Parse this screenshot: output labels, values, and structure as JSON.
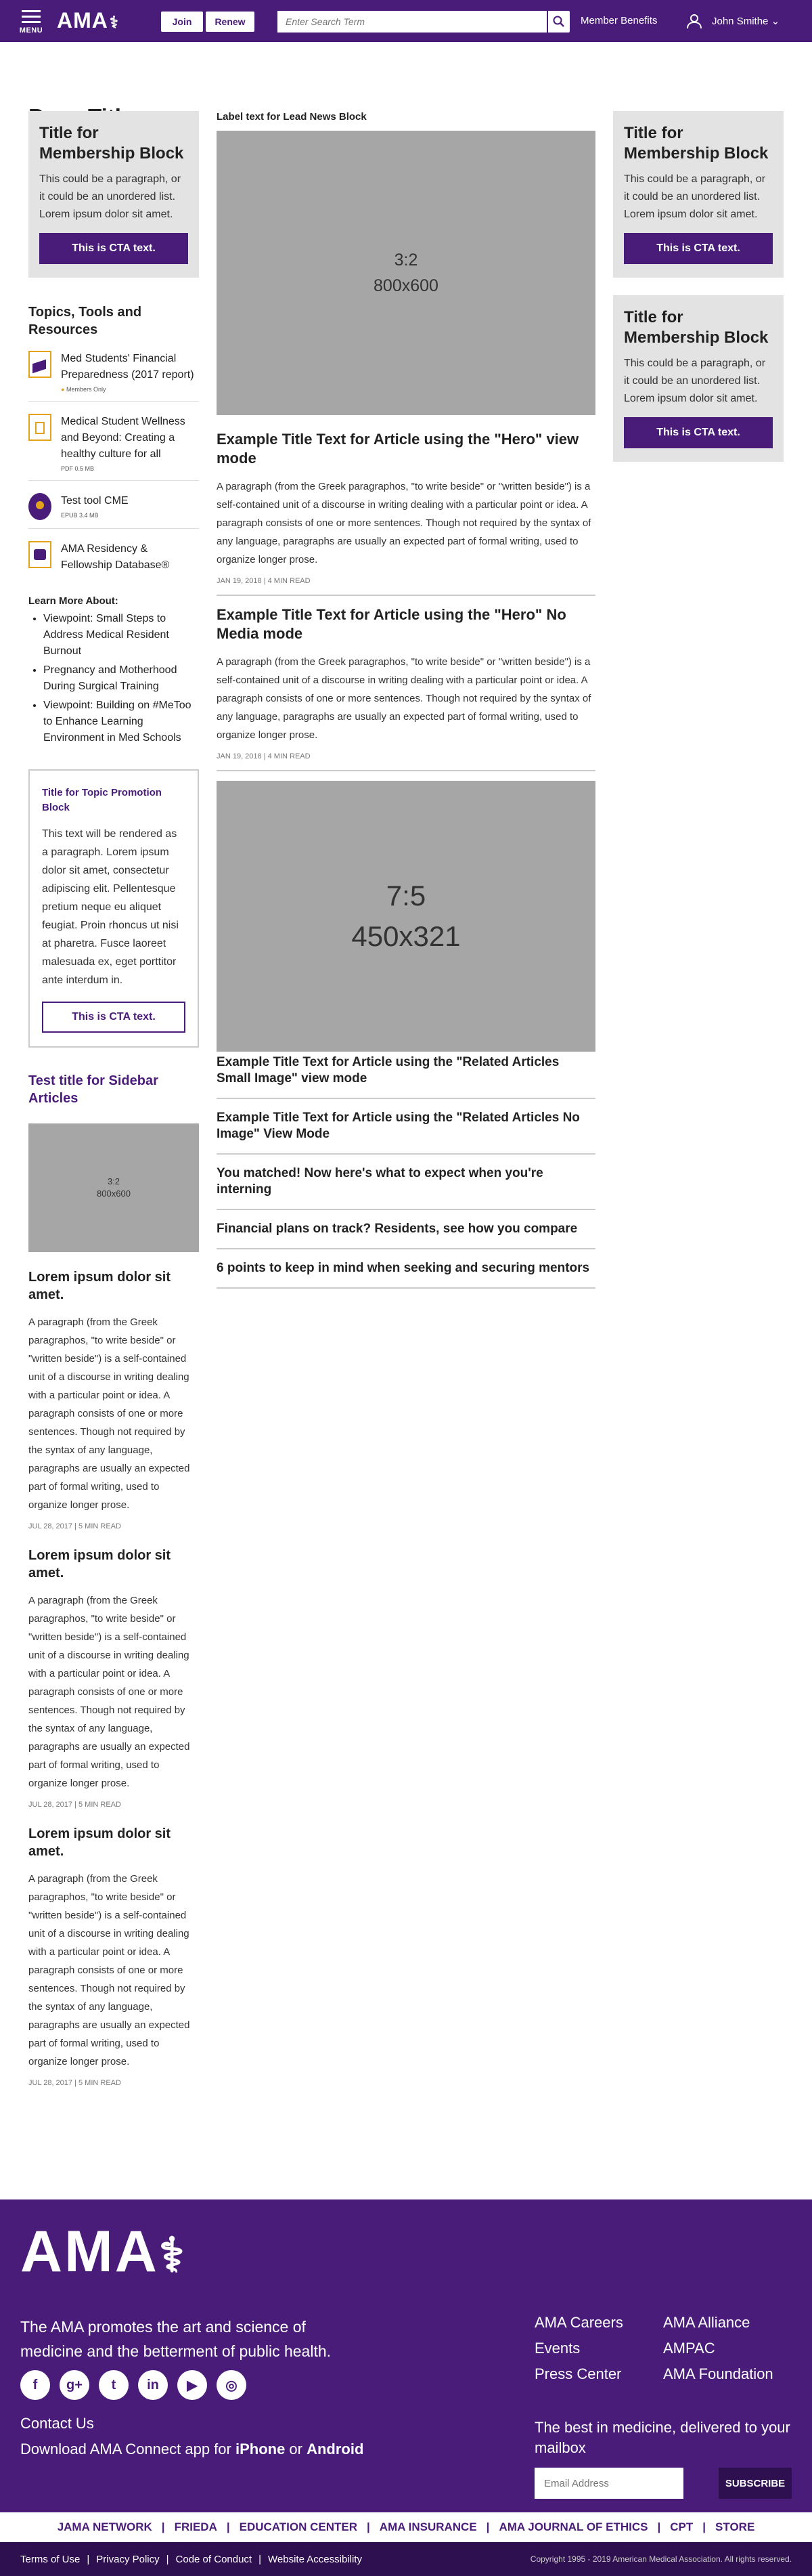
{
  "header": {
    "menu_label": "MENU",
    "logo": "AMA",
    "join": "Join",
    "renew": "Renew",
    "search_placeholder": "Enter Search Term",
    "member_benefits": "Member Benefits",
    "user_name": "John Smithe"
  },
  "page_title": "Page Title",
  "membership": {
    "title": "Title for Membership Block",
    "text": "This could be a paragraph, or it could be an unordered list. Lorem ipsum dolor sit amet.",
    "cta": "This is CTA text."
  },
  "topics": {
    "heading": "Topics, Tools and Resources",
    "items": [
      {
        "title": "Med Students' Financial Preparedness (2017 report)",
        "meta": "Members Only"
      },
      {
        "title": "Medical Student Wellness and Beyond: Creating a healthy culture for all",
        "meta": "PDF          0.5 MB"
      },
      {
        "title": "Test tool CME",
        "meta": "EPUB        3.4 MB"
      },
      {
        "title": "AMA Residency & Fellowship Database®",
        "meta": ""
      }
    ]
  },
  "learn_more": {
    "heading": "Learn More About:",
    "items": [
      "Viewpoint: Small Steps to Address Medical Resident Burnout",
      "Pregnancy and Motherhood During Surgical Training",
      "Viewpoint: Building on #MeToo to Enhance Learning Environment in Med Schools"
    ]
  },
  "promo": {
    "title": "Title for Topic Promotion Block",
    "text": "This text will be rendered as a paragraph. Lorem ipsum dolor sit amet, consectetur adipiscing elit. Pellentesque pretium neque eu aliquet feugiat. Proin rhoncus ut nisi at pharetra. Fusce laoreet malesuada ex, eget porttitor ante interdum in.",
    "cta": "This is CTA text."
  },
  "sidebar": {
    "title": "Test title for Sidebar Articles",
    "image_ratio": "3:2",
    "image_size": "800x600",
    "articles": [
      {
        "title": "Lorem ipsum dolor sit amet.",
        "text": "A paragraph (from the Greek paragraphos, \"to write beside\" or \"written beside\") is a self-contained unit of a discourse in writing dealing with a particular point or idea. A paragraph consists of one or more sentences. Though not required by the syntax of any language, paragraphs are usually an expected part of formal writing, used to organize longer prose.",
        "date": "JUL 28, 2017 | 5 MIN READ"
      },
      {
        "title": "Lorem ipsum dolor sit amet.",
        "text": "A paragraph (from the Greek paragraphos, \"to write beside\" or \"written beside\") is a self-contained unit of a discourse in writing dealing with a particular point or idea. A paragraph consists of one or more sentences. Though not required by the syntax of any language, paragraphs are usually an expected part of formal writing, used to organize longer prose.",
        "date": "JUL 28, 2017 | 5 MIN READ"
      },
      {
        "title": "Lorem ipsum dolor sit amet.",
        "text": "A paragraph (from the Greek paragraphos, \"to write beside\" or \"written beside\") is a self-contained unit of a discourse in writing dealing with a particular point or idea. A paragraph consists of one or more sentences. Though not required by the syntax of any language, paragraphs are usually an expected part of formal writing, used to organize longer prose.",
        "date": "JUL 28, 2017 | 5 MIN READ"
      }
    ]
  },
  "lead": {
    "label": "Label text for Lead News Block",
    "image_ratio": "3:2",
    "image_size": "800x600",
    "hero1": {
      "title": "Example Title Text for Article using the \"Hero\" view mode",
      "text": "A paragraph (from the Greek paragraphos, \"to write beside\" or \"written beside\") is a self-contained unit of a discourse in writing dealing with a particular point or idea. A paragraph consists of one or more sentences. Though not required by the syntax of any language, paragraphs are usually an expected part of formal writing, used to organize longer prose.",
      "date": "JAN 19, 2018 | 4 MIN READ"
    },
    "hero2": {
      "title": "Example Title Text for Article using the \"Hero\" No Media mode",
      "text": "A paragraph (from the Greek paragraphos, \"to write beside\" or \"written beside\") is a self-contained unit of a discourse in writing dealing with a particular point or idea. A paragraph consists of one or more sentences. Though not required by the syntax of any language, paragraphs are usually an expected part of formal writing, used to organize longer prose.",
      "date": "JAN 19, 2018 | 4 MIN READ"
    },
    "small_image_ratio": "7:5",
    "small_image_size": "450x321",
    "related": [
      "Example Title Text for Article using the \"Related Articles Small Image\" view mode",
      "Example Title Text for Article using the \"Related Articles No Image\" View Mode",
      "You matched! Now here's what to expect when you're interning",
      "Financial plans on track? Residents, see how you compare",
      "6 points to keep in mind when seeking and securing mentors"
    ]
  },
  "footer": {
    "logo": "AMA",
    "mission": "The AMA promotes the art and science of medicine and the betterment of public health.",
    "contact": "Contact Us",
    "download_prefix": "Download AMA Connect app for ",
    "iphone": "iPhone",
    "or": " or ",
    "android": "Android",
    "links": [
      "AMA Careers",
      "AMA Alliance",
      "Events",
      "AMPAC",
      "Press Center",
      "AMA Foundation"
    ],
    "newsletter": "The best in medicine, delivered to your mailbox",
    "email_placeholder": "Email Address",
    "subscribe": "SUBSCRIBE",
    "brands": [
      "JAMA NETWORK",
      "FRIEDA",
      "EDUCATION CENTER",
      "AMA INSURANCE",
      "AMA JOURNAL OF ETHICS",
      "CPT",
      "STORE"
    ],
    "legal": [
      "Terms of Use",
      "Privacy Policy",
      "Code of Conduct",
      "Website Accessibility"
    ],
    "copyright": "Copyright 1995 - 2019 American Medical Association. All rights reserved."
  },
  "colors": {
    "brand_purple": "#4a1c7a",
    "dark_purple": "#2e0f50",
    "placeholder_gray": "#a6a6a6"
  }
}
